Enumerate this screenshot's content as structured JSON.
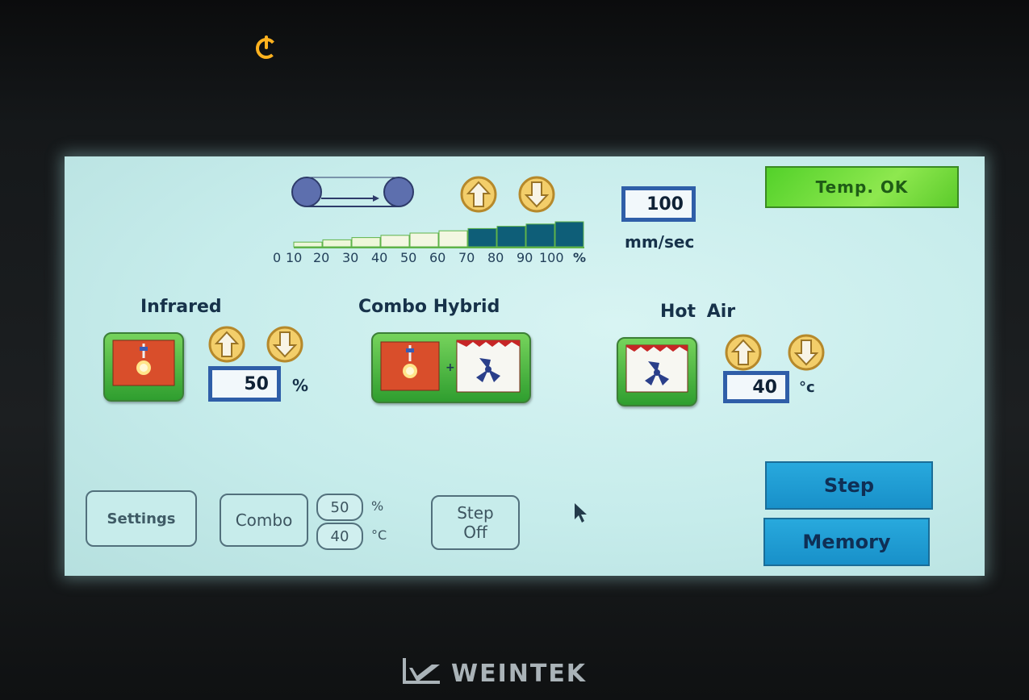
{
  "header": {
    "status": "Temp. OK",
    "speed_value": "100",
    "speed_unit": "mm/sec",
    "scale_labels": [
      "0",
      "10",
      "20",
      "30",
      "40",
      "50",
      "60",
      "70",
      "80",
      "90",
      "100"
    ],
    "scale_unit": "%",
    "speed_level_percent": 100
  },
  "modes": {
    "infrared": {
      "title": "Infrared",
      "value": "50",
      "unit": "%"
    },
    "combo": {
      "title": "Combo Hybrid"
    },
    "hot_air": {
      "title": "Hot Air",
      "value": "40",
      "unit": "°c"
    }
  },
  "footer": {
    "settings_label": "Settings",
    "combo_label": "Combo",
    "combo_percent": "50",
    "combo_percent_unit": "%",
    "combo_temp": "40",
    "combo_temp_unit": "°C",
    "step_off_line1": "Step",
    "step_off_line2": "Off",
    "step_label": "Step",
    "memory_label": "Memory"
  },
  "device": {
    "brand": "WEINTEK"
  },
  "colors": {
    "status_green": "#53d12a",
    "value_border": "#2f5ea8",
    "accent_blue": "#28a9dd",
    "infrared_red": "#d94e2b",
    "bar_dark": "#0e5e78"
  }
}
